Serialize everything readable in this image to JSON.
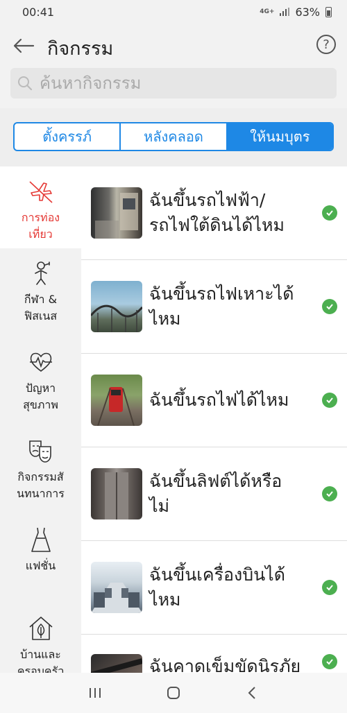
{
  "status_bar": {
    "time": "00:41",
    "network": "4G+",
    "battery": "63%"
  },
  "header": {
    "title": "กิจกรรม",
    "help_label": "?"
  },
  "search": {
    "placeholder": "ค้นหากิจกรรม"
  },
  "tabs": [
    {
      "label": "ตั้งครรภ์",
      "active": false
    },
    {
      "label": "หลังคลอด",
      "active": false
    },
    {
      "label": "ให้นมบุตร",
      "active": true
    }
  ],
  "sidebar": {
    "items": [
      {
        "label": "การท่อง\nเที่ยว",
        "icon": "airplane-icon",
        "active": true
      },
      {
        "label": "กีฬา &\nฟิสเนส",
        "icon": "fitness-icon",
        "active": false
      },
      {
        "label": "ปัญหา\nสุขภาพ",
        "icon": "heartbeat-icon",
        "active": false
      },
      {
        "label": "กิจกรรมสั\nนทนาการ",
        "icon": "theater-masks-icon",
        "active": false
      },
      {
        "label": "แฟชั่น",
        "icon": "dress-icon",
        "active": false
      },
      {
        "label": "บ้านและ\nครอบครัว",
        "icon": "house-icon",
        "active": false
      }
    ]
  },
  "activities": [
    {
      "title": "ฉันขึ้นรถไฟฟ้า/\nรถไฟใต้ดินได้ไหม",
      "status": "check-icon"
    },
    {
      "title": "ฉันขึ้นรถไฟเหาะได้\nไหม",
      "status": "check-icon"
    },
    {
      "title": "ฉันขึ้นรถไฟได้ไหม",
      "status": "check-icon"
    },
    {
      "title": "ฉันขึ้นลิฟต์ได้หรือ\nไม่",
      "status": "check-icon"
    },
    {
      "title": "ฉันขึ้นเครื่องบินได้\nไหม",
      "status": "check-icon"
    },
    {
      "title": "ฉันคาดเข็มขัดนิรภัย",
      "status": "check-icon"
    }
  ],
  "colors": {
    "accent": "#1e88e5",
    "active_category": "#e53935",
    "check": "#4caf50"
  }
}
